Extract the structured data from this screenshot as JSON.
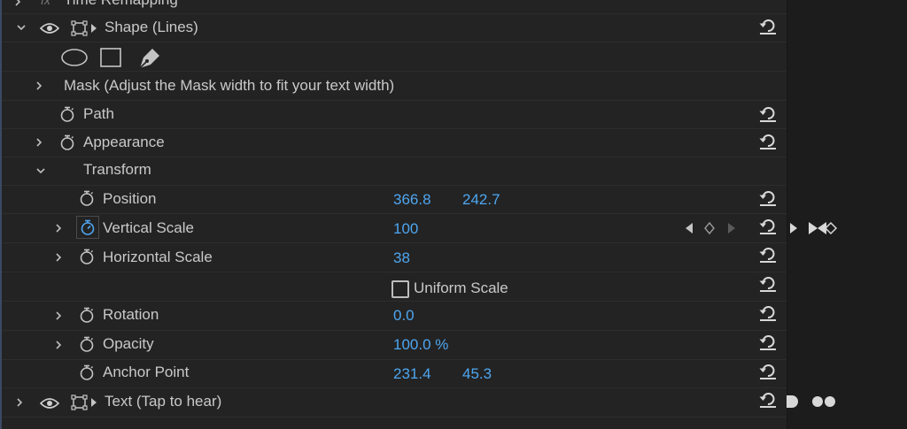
{
  "rows": {
    "time_remapping": {
      "label": "Time Remapping"
    },
    "shape_lines": {
      "label": "Shape (Lines)"
    },
    "mask": {
      "label": "Mask (Adjust the Mask width to fit your text width)"
    },
    "path": {
      "label": "Path"
    },
    "appearance": {
      "label": "Appearance"
    },
    "transform": {
      "label": "Transform"
    },
    "position": {
      "label": "Position",
      "x": "366.8",
      "y": "242.7"
    },
    "vertical_scale": {
      "label": "Vertical Scale",
      "value": "100"
    },
    "horizontal_scale": {
      "label": "Horizontal Scale",
      "value": "38"
    },
    "uniform_scale": {
      "label": "Uniform Scale"
    },
    "rotation": {
      "label": "Rotation",
      "value": "0.0"
    },
    "opacity": {
      "label": "Opacity",
      "value": "100.0 %"
    },
    "anchor_point": {
      "label": "Anchor Point",
      "x": "231.4",
      "y": "45.3"
    },
    "text_tap": {
      "label": "Text (Tap to hear)"
    }
  },
  "colors": {
    "background": "#232323",
    "label": "#c9c9c9",
    "value": "#4ea6f0",
    "timeline": "#1c1c1c"
  }
}
